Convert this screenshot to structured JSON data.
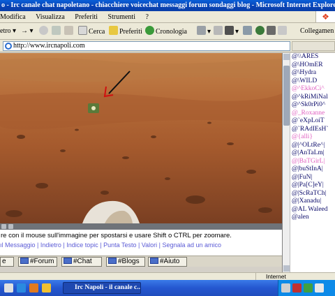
{
  "window": {
    "title": "o - Irc canale chat napoletano - chiacchiere voicechat messaggi forum sondaggi blog - Microsoft Internet Explorer"
  },
  "menu": {
    "items": [
      "Modifica",
      "Visualizza",
      "Preferiti",
      "Strumenti",
      "?"
    ]
  },
  "toolbar": {
    "forward_label": "etro",
    "search_label": "Cerca",
    "favorites_label": "Preferiti",
    "history_label": "Cronologia",
    "connections_label": "Collegamen"
  },
  "address": {
    "url": "http://www.ircnapoli.com"
  },
  "content": {
    "caption": "re con il mouse sull'immagine per spostarsi e usare Shift o CTRL per zoomare.",
    "links_row": "ıl Messaggio | Indietro | Indice topic | Punta Testo | Valori | Segnala ad un amico"
  },
  "tabs": [
    {
      "label": "e"
    },
    {
      "label": "#Forum"
    },
    {
      "label": "#Chat"
    },
    {
      "label": "#Blogs"
    },
    {
      "label": "#Aiuto"
    }
  ],
  "users": [
    {
      "name": "@\\\\ARES",
      "color": "#0a0a6a"
    },
    {
      "name": "@\\HOmER",
      "color": "#0a0a6a"
    },
    {
      "name": "@\\Hydra",
      "color": "#0a0a6a"
    },
    {
      "name": "@\\WILD",
      "color": "#0a0a6a"
    },
    {
      "name": "@^EkkoCi^",
      "color": "#e060c0"
    },
    {
      "name": "@^kRiMiNal",
      "color": "#0a0a6a"
    },
    {
      "name": "@^Sk0rPi0^",
      "color": "#0a0a6a"
    },
    {
      "name": "@_Roxanne",
      "color": "#e060c0"
    },
    {
      "name": "@`eXpLoiT",
      "color": "#0a0a6a"
    },
    {
      "name": "@`RAdIEsH`",
      "color": "#0a0a6a"
    },
    {
      "name": "@{alli}",
      "color": "#e060c0"
    },
    {
      "name": "@|^OLtRe^|",
      "color": "#0a0a6a"
    },
    {
      "name": "@|AnTaLm|",
      "color": "#0a0a6a"
    },
    {
      "name": "@|BaTGirL|",
      "color": "#e060c0"
    },
    {
      "name": "@|buStInA|",
      "color": "#0a0a6a"
    },
    {
      "name": "@|FuN|",
      "color": "#0a0a6a"
    },
    {
      "name": "@|Pa[C]eY|",
      "color": "#0a0a6a"
    },
    {
      "name": "@|ScRaTCh|",
      "color": "#0a0a6a"
    },
    {
      "name": "@|Xanadu|",
      "color": "#0a0a6a"
    },
    {
      "name": "@AL Waleed",
      "color": "#0a0a6a"
    },
    {
      "name": "@alen",
      "color": "#0a0a6a"
    }
  ],
  "status": {
    "zone": "Internet"
  },
  "taskbar": {
    "task_label": "Irc Napoli - il canale c..."
  }
}
